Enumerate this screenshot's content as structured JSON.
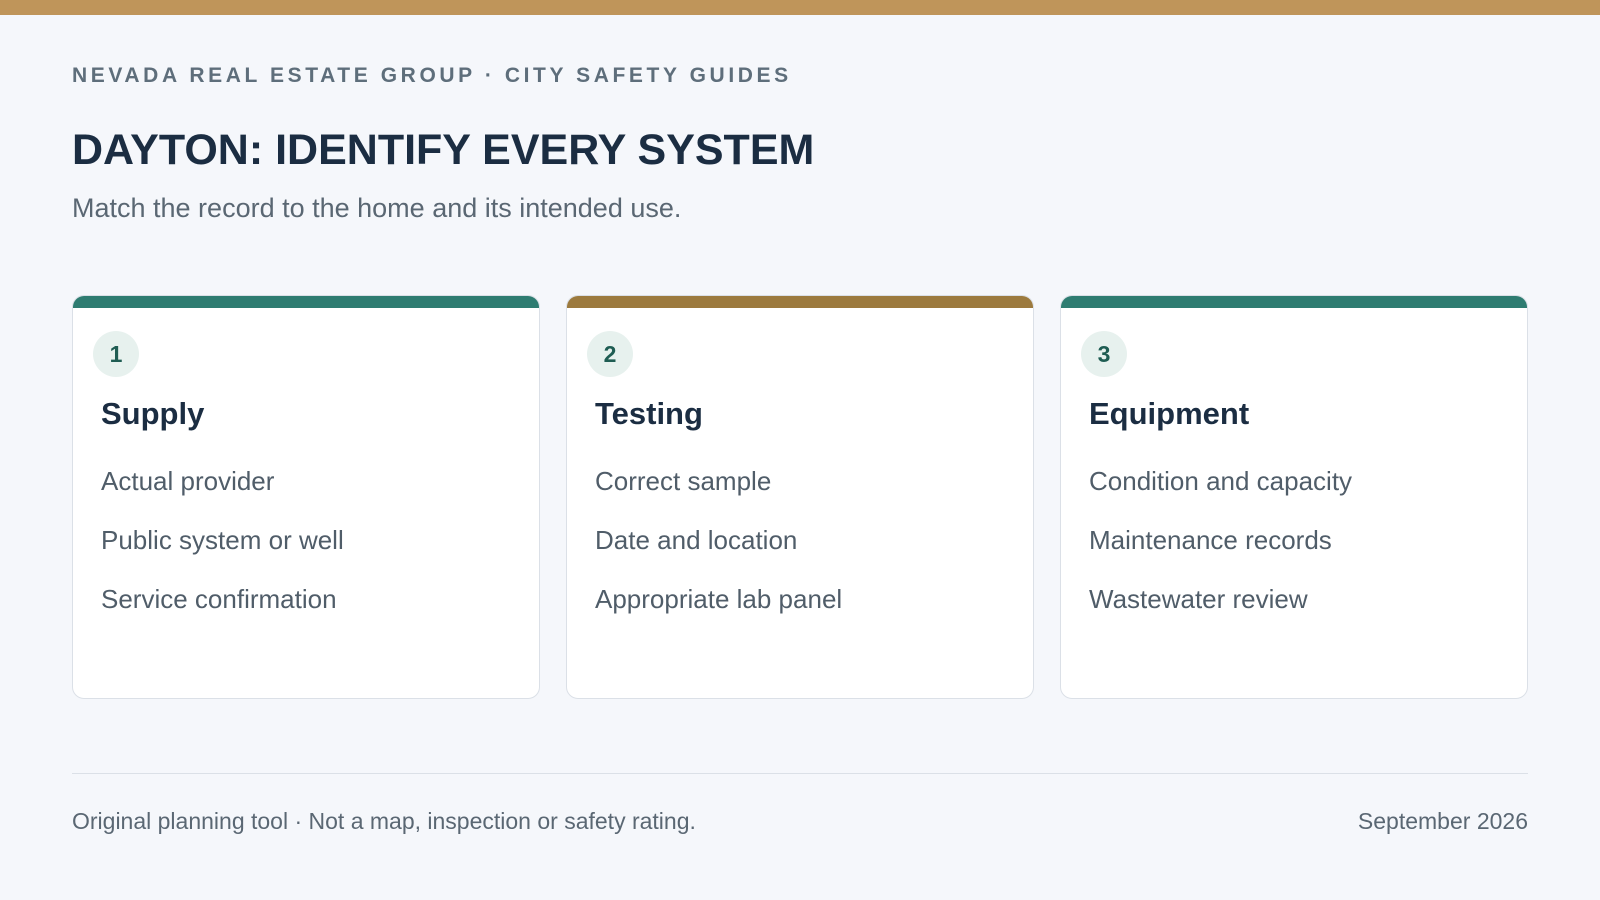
{
  "header": {
    "eyebrow": "NEVADA REAL ESTATE GROUP · CITY SAFETY GUIDES",
    "title": "DAYTON: IDENTIFY EVERY SYSTEM",
    "subtitle": "Match the record to the home and its intended use."
  },
  "colors": {
    "top_bar": "#bf955a",
    "teal_accent": "#2e7c71",
    "gold_accent": "#9c7a3e"
  },
  "cards": [
    {
      "number": "1",
      "title": "Supply",
      "accent": "#2e7c71",
      "items": [
        "Actual provider",
        "Public system or well",
        "Service confirmation"
      ]
    },
    {
      "number": "2",
      "title": "Testing",
      "accent": "#9c7a3e",
      "items": [
        "Correct sample",
        "Date and location",
        "Appropriate lab panel"
      ]
    },
    {
      "number": "3",
      "title": "Equipment",
      "accent": "#2e7c71",
      "items": [
        "Condition and capacity",
        "Maintenance records",
        "Wastewater review"
      ]
    }
  ],
  "footer": {
    "note": "Original planning tool · Not a map, inspection or safety rating.",
    "date": "September 2026"
  }
}
